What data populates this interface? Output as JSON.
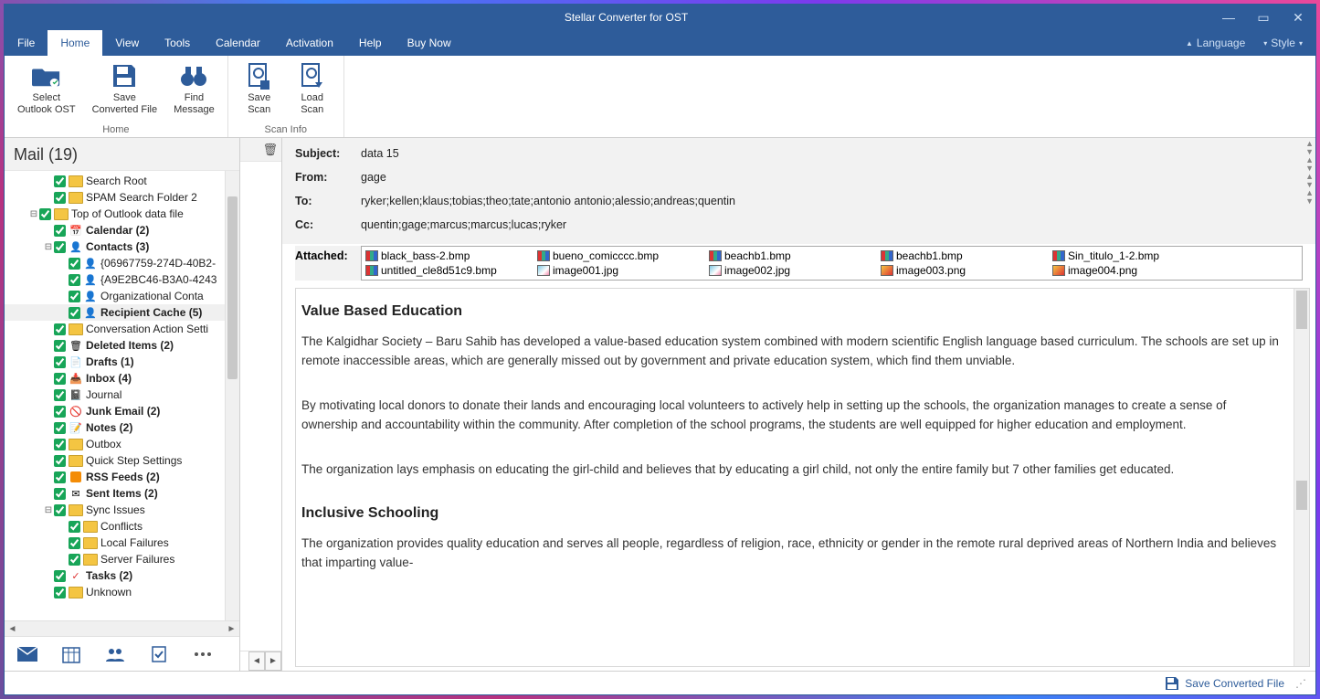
{
  "app_title": "Stellar Converter for OST",
  "window_controls": {
    "min": "—",
    "max": "▭",
    "close": "✕"
  },
  "menu": {
    "items": [
      "File",
      "Home",
      "View",
      "Tools",
      "Calendar",
      "Activation",
      "Help",
      "Buy Now"
    ],
    "active": "Home",
    "right": {
      "lang_caret": "▲",
      "lang_label": "Language",
      "style_caret": "▾",
      "style_label": "Style",
      "style_caret2": "▾"
    }
  },
  "ribbon": {
    "groups": [
      {
        "label": "Home",
        "buttons": [
          {
            "id": "select-ost",
            "line1": "Select",
            "line2": "Outlook OST"
          },
          {
            "id": "save-conv",
            "line1": "Save",
            "line2": "Converted File"
          },
          {
            "id": "find-msg",
            "line1": "Find",
            "line2": "Message"
          }
        ]
      },
      {
        "label": "Scan Info",
        "buttons": [
          {
            "id": "save-scan",
            "line1": "Save",
            "line2": "Scan"
          },
          {
            "id": "load-scan",
            "line1": "Load",
            "line2": "Scan"
          }
        ]
      }
    ]
  },
  "left": {
    "header": "Mail (19)",
    "tree": [
      {
        "d": 2,
        "exp": "",
        "icon": "folder",
        "label": "Search Root"
      },
      {
        "d": 2,
        "exp": "",
        "icon": "folder",
        "label": "SPAM Search Folder 2"
      },
      {
        "d": 1,
        "exp": "⊟",
        "icon": "folder",
        "label": "Top of Outlook data file"
      },
      {
        "d": 2,
        "exp": "",
        "icon": "cal",
        "label": "Calendar (2)",
        "bold": true
      },
      {
        "d": 2,
        "exp": "⊟",
        "icon": "contact",
        "label": "Contacts (3)",
        "bold": true
      },
      {
        "d": 3,
        "exp": "",
        "icon": "contact",
        "label": "{06967759-274D-40B2-"
      },
      {
        "d": 3,
        "exp": "",
        "icon": "contact",
        "label": "{A9E2BC46-B3A0-4243"
      },
      {
        "d": 3,
        "exp": "",
        "icon": "contact",
        "label": "Organizational Conta"
      },
      {
        "d": 3,
        "exp": "",
        "icon": "contact",
        "label": "Recipient Cache (5)",
        "bold": true,
        "selected": true
      },
      {
        "d": 2,
        "exp": "",
        "icon": "folder",
        "label": "Conversation Action Setti"
      },
      {
        "d": 2,
        "exp": "",
        "icon": "del",
        "label": "Deleted Items (2)",
        "bold": true
      },
      {
        "d": 2,
        "exp": "",
        "icon": "draft",
        "label": "Drafts (1)",
        "bold": true
      },
      {
        "d": 2,
        "exp": "",
        "icon": "inbox",
        "label": "Inbox (4)",
        "bold": true
      },
      {
        "d": 2,
        "exp": "",
        "icon": "journal",
        "label": "Journal"
      },
      {
        "d": 2,
        "exp": "",
        "icon": "junk",
        "label": "Junk Email (2)",
        "bold": true
      },
      {
        "d": 2,
        "exp": "",
        "icon": "note",
        "label": "Notes (2)",
        "bold": true
      },
      {
        "d": 2,
        "exp": "",
        "icon": "folder",
        "label": "Outbox"
      },
      {
        "d": 2,
        "exp": "",
        "icon": "folder",
        "label": "Quick Step Settings"
      },
      {
        "d": 2,
        "exp": "",
        "icon": "rss",
        "label": "RSS Feeds (2)",
        "bold": true
      },
      {
        "d": 2,
        "exp": "",
        "icon": "sent",
        "label": "Sent Items (2)",
        "bold": true
      },
      {
        "d": 2,
        "exp": "⊟",
        "icon": "folder",
        "label": "Sync Issues"
      },
      {
        "d": 3,
        "exp": "",
        "icon": "folder",
        "label": "Conflicts"
      },
      {
        "d": 3,
        "exp": "",
        "icon": "folder",
        "label": "Local Failures"
      },
      {
        "d": 3,
        "exp": "",
        "icon": "folder",
        "label": "Server Failures"
      },
      {
        "d": 2,
        "exp": "",
        "icon": "task",
        "label": "Tasks (2)",
        "bold": true
      },
      {
        "d": 2,
        "exp": "",
        "icon": "folder",
        "label": "Unknown"
      }
    ],
    "bottom_nav": [
      "mail",
      "calendar",
      "people",
      "tasks",
      "more"
    ]
  },
  "message": {
    "labels": {
      "subject": "Subject:",
      "from": "From:",
      "to": "To:",
      "cc": "Cc:",
      "attached": "Attached:"
    },
    "subject": "data 15",
    "from": "gage",
    "to": "ryker;kellen;klaus;tobias;theo;tate;antonio antonio;alessio;andreas;quentin",
    "cc": "quentin;gage;marcus;marcus;lucas;ryker",
    "attachments": [
      {
        "name": "black_bass-2.bmp",
        "t": "bmp"
      },
      {
        "name": "bueno_comicccc.bmp",
        "t": "bmp"
      },
      {
        "name": "beachb1.bmp",
        "t": "bmp"
      },
      {
        "name": "beachb1.bmp",
        "t": "bmp"
      },
      {
        "name": "Sin_titulo_1-2.bmp",
        "t": "bmp"
      },
      {
        "name": "untitled_cle8d51c9.bmp",
        "t": "bmp"
      },
      {
        "name": "image001.jpg",
        "t": "jpg"
      },
      {
        "name": "image002.jpg",
        "t": "jpg"
      },
      {
        "name": "image003.png",
        "t": "png"
      },
      {
        "name": "image004.png",
        "t": "png"
      }
    ],
    "body": {
      "h1": "Value Based Education",
      "p1": "The Kalgidhar Society – Baru Sahib has developed a value-based education system combined with modern scientific English language based curriculum. The schools are set up in remote inaccessible areas, which are generally missed out by government and private education system, which find them unviable.",
      "p2": "By motivating local donors to donate their lands and encouraging local volunteers to actively help in setting up the schools, the organization manages to create a sense of ownership and accountability within the community. After completion of the school programs, the students are well equipped for higher education and employment.",
      "p3": "The organization lays emphasis on educating the girl-child and believes that by educating a girl child, not only the entire family but 7 other families get educated.",
      "h2": "Inclusive Schooling",
      "p4": "The organization provides quality education and serves all people, regardless of religion, race, ethnicity or gender in the remote rural deprived areas of Northern India and believes that imparting value-"
    }
  },
  "status": {
    "save_label": "Save Converted File"
  }
}
